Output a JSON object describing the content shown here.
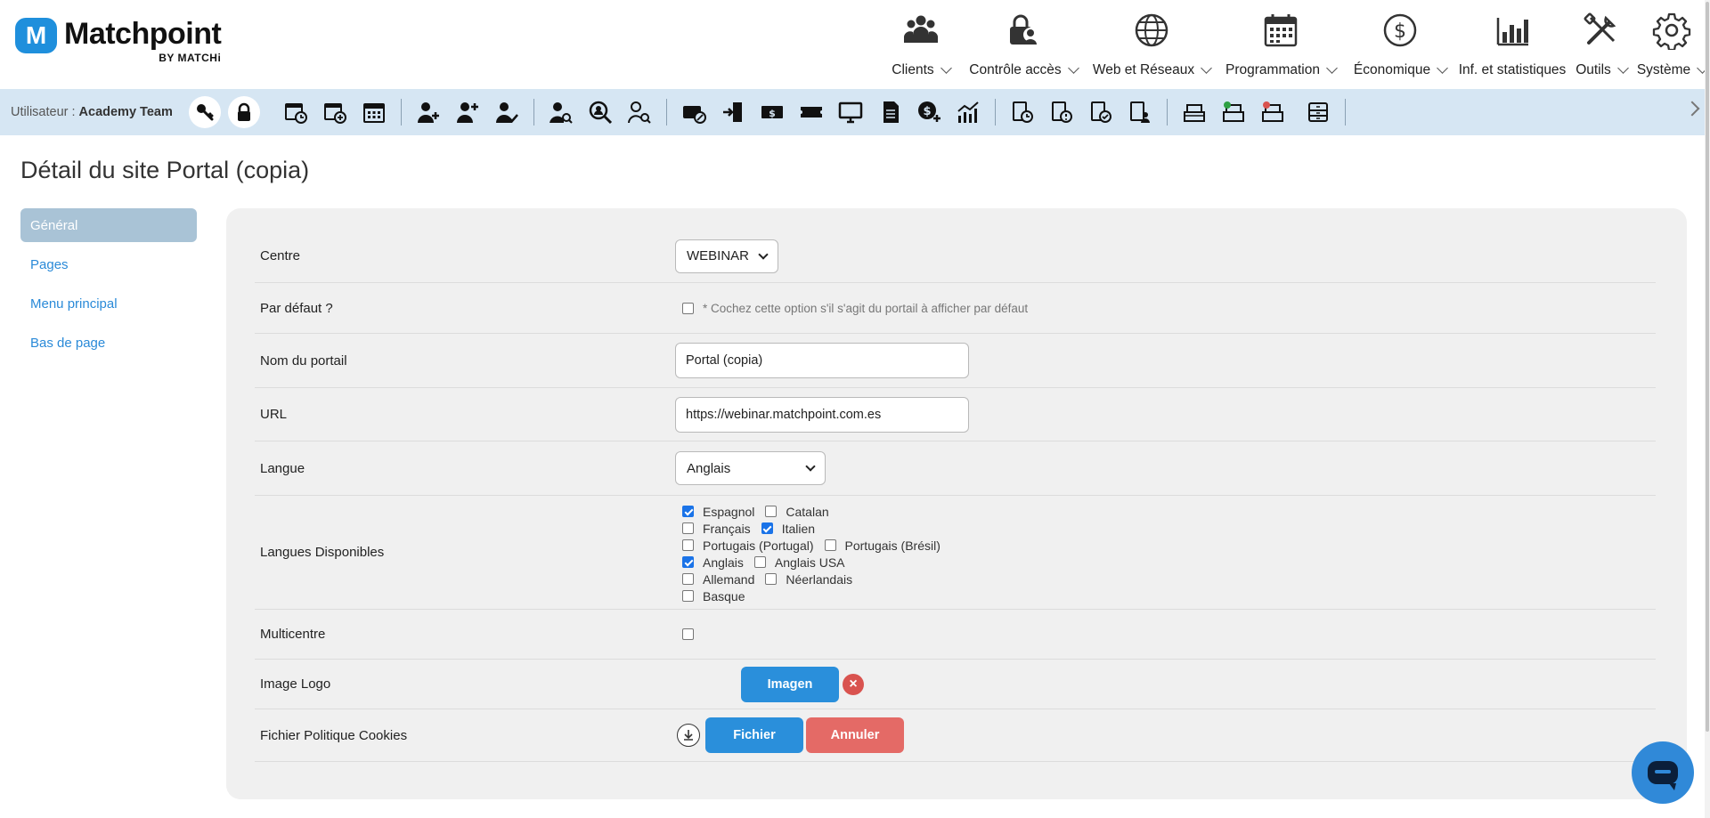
{
  "brand": {
    "badge": "M",
    "title": "Matchpoint",
    "subtitle": "BY MATCHi"
  },
  "mainnav": [
    {
      "label": "Clients",
      "icon": "users-icon",
      "dropdown": true
    },
    {
      "label": "Contrôle accès",
      "icon": "access-lock-user-icon",
      "dropdown": true
    },
    {
      "label": "Web et Réseaux",
      "icon": "globe-icon",
      "dropdown": true
    },
    {
      "label": "Programmation",
      "icon": "calendar-icon",
      "dropdown": true
    },
    {
      "label": "Économique",
      "icon": "dollar-circle-icon",
      "dropdown": true
    },
    {
      "label": "Inf. et statistiques",
      "icon": "bar-chart-icon",
      "dropdown": false
    },
    {
      "label": "Outils",
      "icon": "tools-icon",
      "dropdown": true
    },
    {
      "label": "Système",
      "icon": "gear-icon",
      "dropdown": true
    }
  ],
  "toolbar": {
    "user_label": "Utilisateur :",
    "user_name": "Academy Team"
  },
  "page": {
    "title": "Détail du site Portal (copia)"
  },
  "sidenav": [
    {
      "label": "Général",
      "active": true
    },
    {
      "label": "Pages",
      "active": false
    },
    {
      "label": "Menu principal",
      "active": false
    },
    {
      "label": "Bas de page",
      "active": false
    }
  ],
  "form": {
    "centre": {
      "label": "Centre",
      "value": "WEBINAR"
    },
    "default": {
      "label": "Par défaut ?",
      "hint": "* Cochez cette option s'il s'agit du portail à afficher par défaut",
      "checked": false
    },
    "name": {
      "label": "Nom du portail",
      "value": "Portal (copia)"
    },
    "url": {
      "label": "URL",
      "value": "https://webinar.matchpoint.com.es"
    },
    "language": {
      "label": "Langue",
      "value": "Anglais"
    },
    "available_languages": {
      "label": "Langues Disponibles",
      "lines": [
        [
          {
            "name": "Espagnol",
            "checked": true
          },
          {
            "name": "Catalan",
            "checked": false
          }
        ],
        [
          {
            "name": "Français",
            "checked": false
          },
          {
            "name": "Italien",
            "checked": true
          }
        ],
        [
          {
            "name": "Portugais (Portugal)",
            "checked": false
          },
          {
            "name": "Portugais (Brésil)",
            "checked": false
          }
        ],
        [
          {
            "name": "Anglais",
            "checked": true
          },
          {
            "name": "Anglais USA",
            "checked": false
          }
        ],
        [
          {
            "name": "Allemand",
            "checked": false
          },
          {
            "name": "Néerlandais",
            "checked": false
          }
        ],
        [
          {
            "name": "Basque",
            "checked": false
          }
        ]
      ]
    },
    "multicentre": {
      "label": "Multicentre",
      "checked": false
    },
    "logo": {
      "label": "Image Logo",
      "button": "Imagen",
      "remove": "×"
    },
    "cookies": {
      "label": "Fichier Politique Cookies",
      "file_button": "Fichier",
      "cancel_button": "Annuler"
    }
  },
  "colors": {
    "accent": "#2a8fdb",
    "toolbar_bg": "#d6e6f3",
    "danger": "#e46a66"
  }
}
